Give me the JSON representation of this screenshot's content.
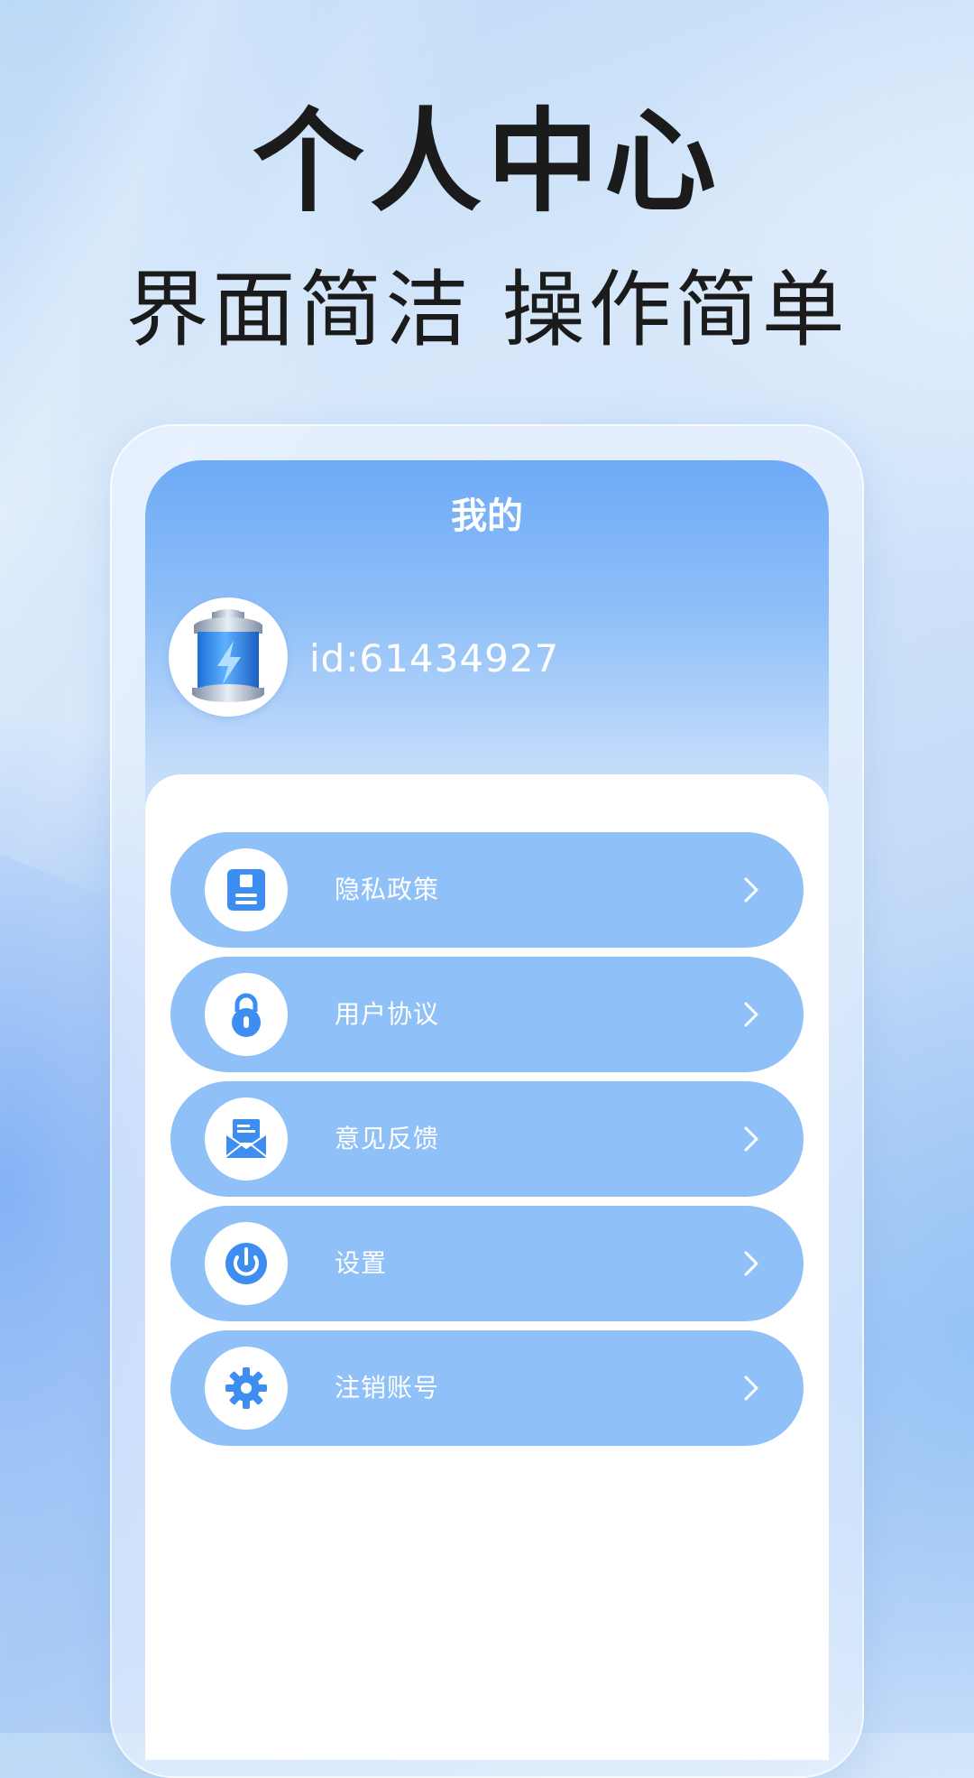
{
  "hero": {
    "title": "个人中心",
    "subtitle": "界面简洁 操作简单"
  },
  "screen": {
    "title": "我的",
    "user_id": "id:61434927",
    "avatar_icon": "battery-icon"
  },
  "menu": [
    {
      "label": "隐私政策",
      "icon": "document-icon"
    },
    {
      "label": "用户协议",
      "icon": "lock-icon"
    },
    {
      "label": "意见反馈",
      "icon": "mail-icon"
    },
    {
      "label": "设置",
      "icon": "power-icon"
    },
    {
      "label": "注销账号",
      "icon": "gear-icon"
    }
  ],
  "colors": {
    "accent": "#3d8ef0",
    "menu_bg": "#8fc0f8",
    "header_top": "#6eaaf7"
  }
}
